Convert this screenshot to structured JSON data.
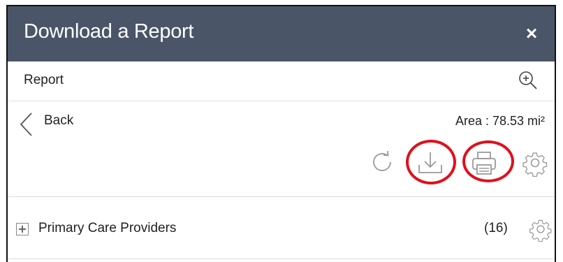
{
  "header": {
    "title": "Download a Report",
    "close_label": "×"
  },
  "subheader": {
    "title": "Report",
    "zoom_icon": "zoom-in-icon"
  },
  "nav": {
    "back_label": "Back",
    "area_text": "Area : 78.53 mi²"
  },
  "actions": {
    "icons": [
      "refresh-icon",
      "download-icon",
      "print-icon",
      "settings-icon"
    ],
    "highlight_color": "#e0101a"
  },
  "list": {
    "items": [
      {
        "label": "Primary Care Providers",
        "count": "(16)"
      }
    ]
  },
  "colors": {
    "header_bg": "#4a5568",
    "header_text": "#ffffff",
    "icon_gray": "#9a9a9a"
  }
}
